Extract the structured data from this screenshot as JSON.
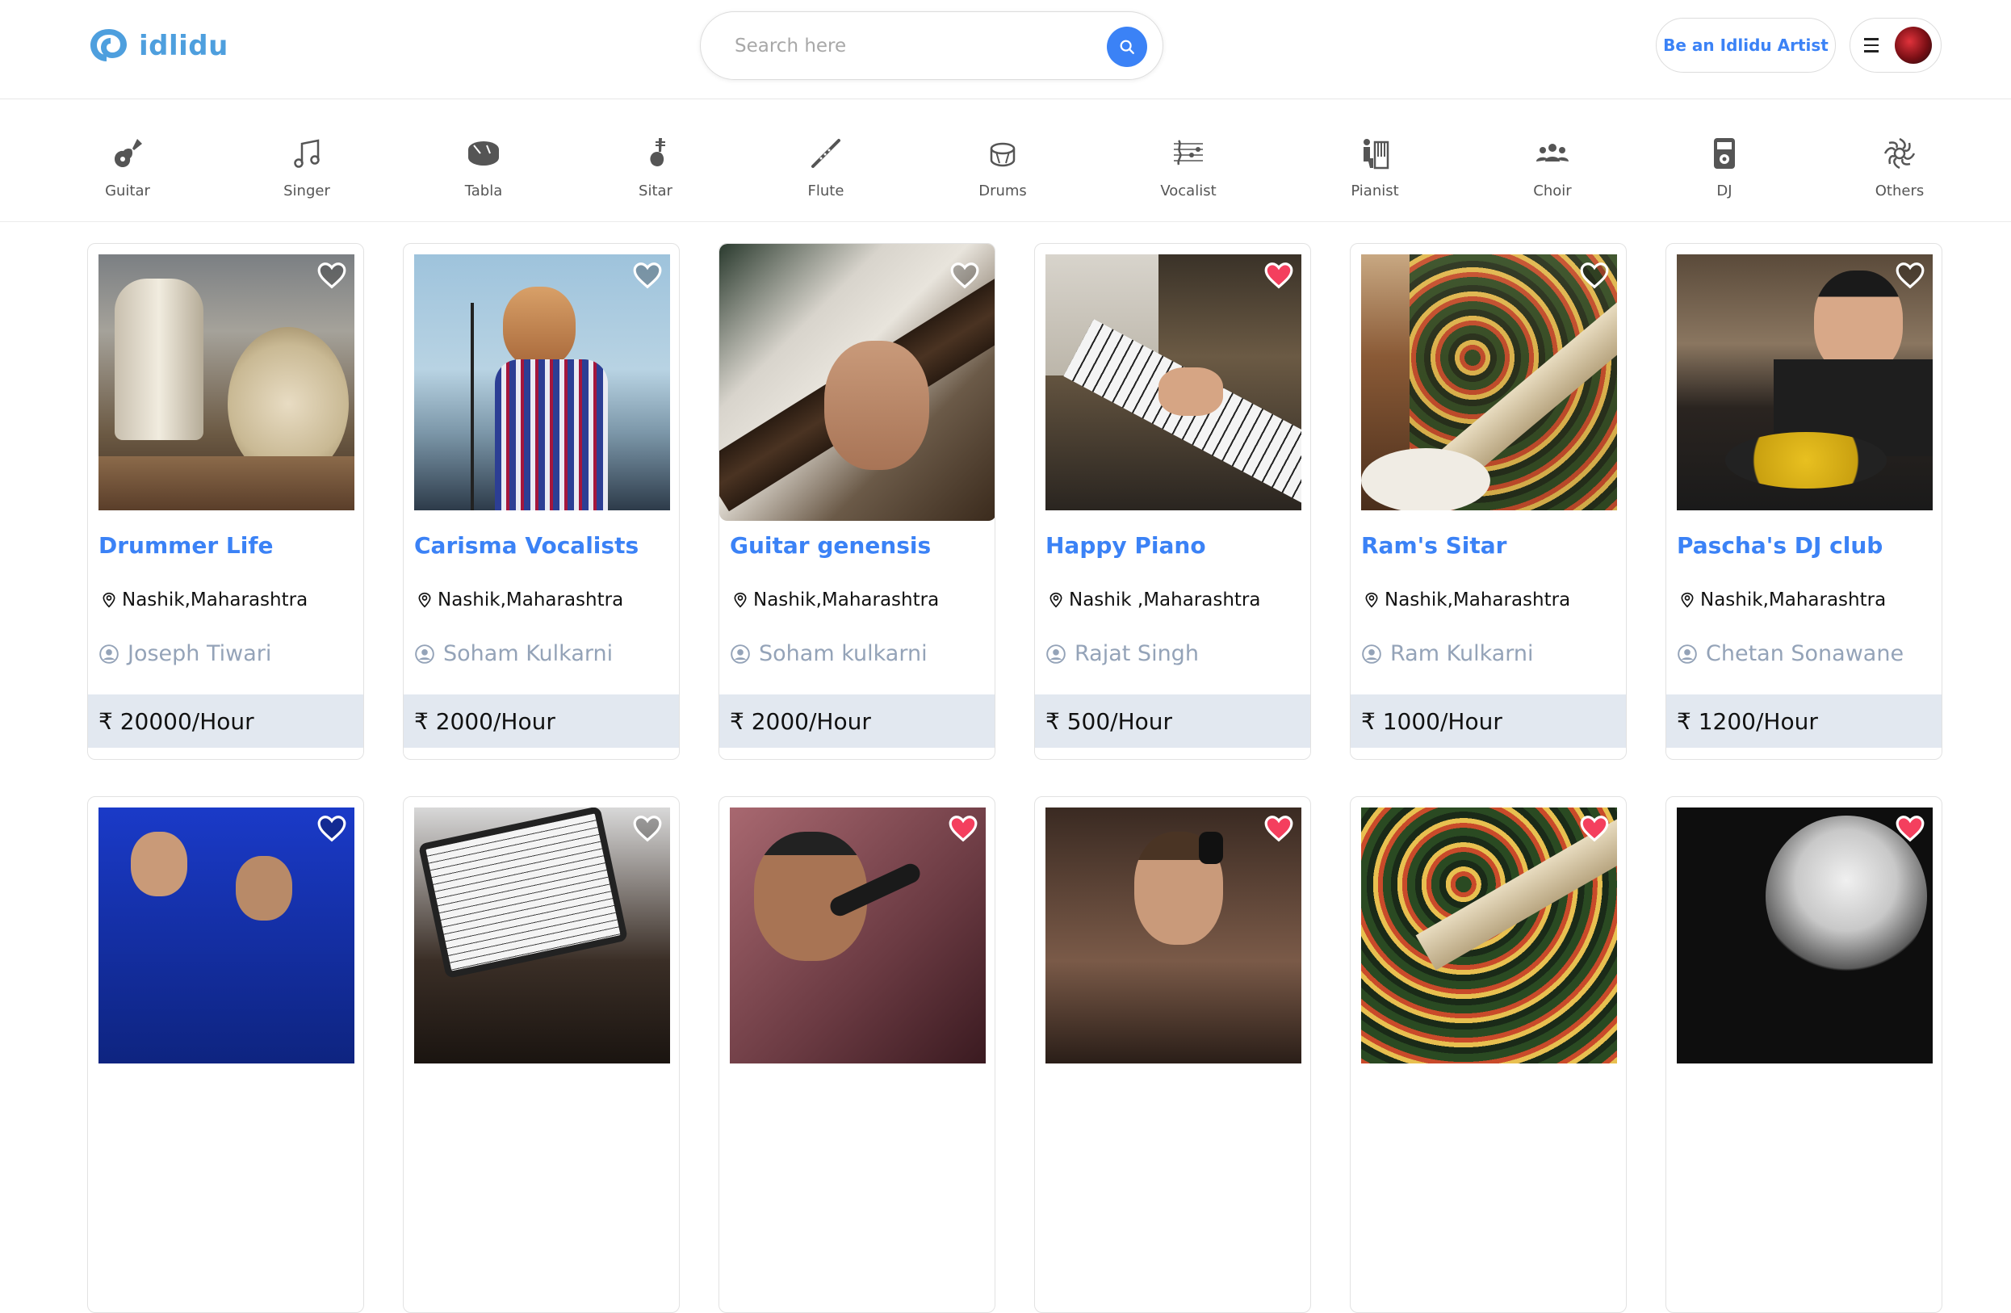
{
  "brand": {
    "name": "idlidu",
    "accent": "#3b82f6",
    "logo_color": "#4e9fde"
  },
  "search": {
    "placeholder": "Search here",
    "icon": "search-icon"
  },
  "header": {
    "artist_cta": "Be an Idlidu Artist",
    "menu_icon": "hamburger-icon"
  },
  "categories": [
    {
      "label": "Guitar",
      "icon": "guitar-icon"
    },
    {
      "label": "Singer",
      "icon": "music-note-icon"
    },
    {
      "label": "Tabla",
      "icon": "tabla-icon"
    },
    {
      "label": "Sitar",
      "icon": "sitar-icon"
    },
    {
      "label": "Flute",
      "icon": "flute-icon"
    },
    {
      "label": "Drums",
      "icon": "drum-icon"
    },
    {
      "label": "Vocalist",
      "icon": "sheet-music-icon"
    },
    {
      "label": "Pianist",
      "icon": "pianist-icon"
    },
    {
      "label": "Choir",
      "icon": "choir-icon"
    },
    {
      "label": "DJ",
      "icon": "dj-icon"
    },
    {
      "label": "Others",
      "icon": "others-icon"
    }
  ],
  "cards": [
    {
      "title": "Drummer Life",
      "location": "Nashik,Maharashtra",
      "owner": "Joseph Tiwari",
      "price": "₹ 20000/Hour",
      "favorited": false,
      "image": "drum-kit-photo"
    },
    {
      "title": "Carisma Vocalists",
      "location": "Nashik,Maharashtra",
      "owner": "Soham Kulkarni",
      "price": "₹ 2000/Hour",
      "favorited": false,
      "image": "singer-on-stage-photo"
    },
    {
      "title": "Guitar genensis",
      "location": "Nashik,Maharashtra",
      "owner": "Soham kulkarni",
      "price": "₹ 2000/Hour",
      "favorited": false,
      "image": "guitar-closeup-photo"
    },
    {
      "title": "Happy Piano",
      "location": "Nashik ,Maharashtra",
      "owner": "Rajat Singh",
      "price": "₹ 500/Hour",
      "favorited": true,
      "image": "piano-keys-photo"
    },
    {
      "title": "Ram's Sitar",
      "location": "Nashik,Maharashtra",
      "owner": "Ram Kulkarni",
      "price": "₹ 1000/Hour",
      "favorited": false,
      "image": "sitar-player-photo"
    },
    {
      "title": "Pascha's DJ club",
      "location": "Nashik,Maharashtra",
      "owner": "Chetan Sonawane",
      "price": "₹ 1200/Hour",
      "favorited": false,
      "image": "dj-turntable-photo"
    }
  ],
  "cards_row2": [
    {
      "favorited": false,
      "image": "saxophone-band-photo"
    },
    {
      "favorited": false,
      "image": "sheet-music-tablet-photo"
    },
    {
      "favorited": true,
      "image": "singer-microphone-photo"
    },
    {
      "favorited": true,
      "image": "headphones-musician-photo"
    },
    {
      "favorited": true,
      "image": "sitar-closeup-photo"
    },
    {
      "favorited": true,
      "image": "elderly-musician-photo"
    }
  ]
}
